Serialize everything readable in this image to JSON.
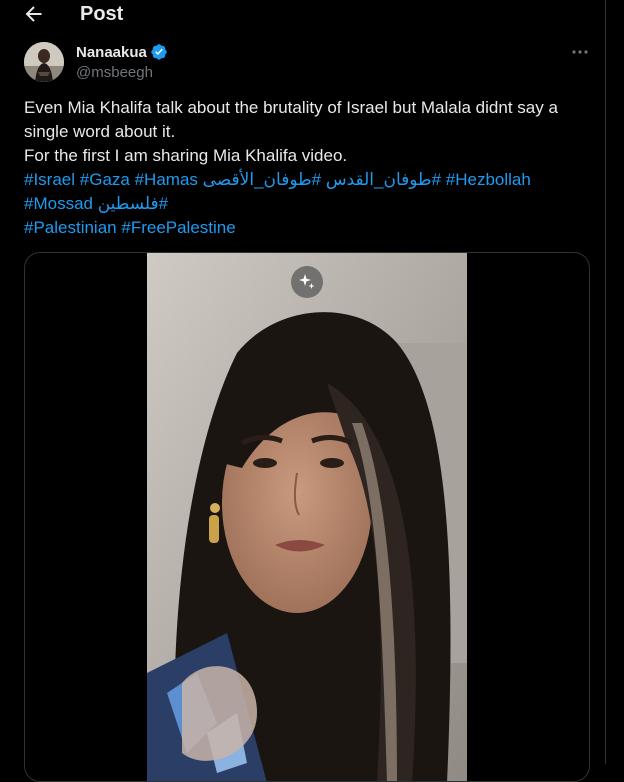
{
  "header": {
    "title": "Post",
    "back_icon": "arrow-left-icon"
  },
  "author": {
    "display_name": "Nanaakua",
    "handle": "@msbeegh",
    "verified": true,
    "verified_color": "#1d9bf0"
  },
  "tweet": {
    "lines": [
      [
        {
          "text": "Even Mia Khalifa talk about the brutality of Israel but Malala didnt say a",
          "type": "text"
        }
      ],
      [
        {
          "text": "single word about it.",
          "type": "text"
        }
      ],
      [
        {
          "text": "For the first I am sharing Mia Khalifa video.",
          "type": "text"
        }
      ],
      [
        {
          "text": "#Israel",
          "type": "hashtag"
        },
        {
          "text": " ",
          "type": "text"
        },
        {
          "text": "#Gaza",
          "type": "hashtag"
        },
        {
          "text": " ",
          "type": "text"
        },
        {
          "text": "#Hamas",
          "type": "hashtag"
        },
        {
          "text": " ",
          "type": "text"
        },
        {
          "text": "#طوفان_الأقصى",
          "type": "hashtag"
        },
        {
          "text": " ",
          "type": "text"
        },
        {
          "text": "#طوفان_القدس",
          "type": "hashtag"
        },
        {
          "text": " ",
          "type": "text"
        },
        {
          "text": "#Hezbollah",
          "type": "hashtag"
        }
      ],
      [
        {
          "text": "#Mossad",
          "type": "hashtag"
        },
        {
          "text": " ",
          "type": "text"
        },
        {
          "text": "#فلسطين",
          "type": "hashtag"
        }
      ],
      [
        {
          "text": "#Palestinian",
          "type": "hashtag"
        },
        {
          "text": " ",
          "type": "text"
        },
        {
          "text": "#FreePalestine",
          "type": "hashtag"
        }
      ]
    ]
  },
  "media": {
    "kind": "video",
    "badge_icon": "sparkle-icon"
  },
  "colors": {
    "background": "#000000",
    "text": "#e7e9ea",
    "secondary_text": "#71767b",
    "link": "#1d9bf0",
    "border": "#2f3336"
  }
}
